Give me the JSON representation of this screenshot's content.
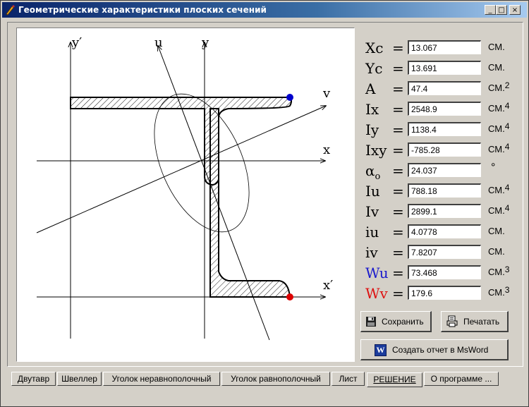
{
  "window": {
    "title": "Геометрические характеристики плоских сечений",
    "controls": {
      "minimize": "_",
      "maximize": "□",
      "close": "×"
    }
  },
  "diagram": {
    "labels": {
      "y_prime": "y′",
      "u": "u",
      "y": "y",
      "v": "v",
      "x": "x",
      "x_prime": "x′"
    },
    "colors": {
      "top_point": "#0000cc",
      "bottom_point": "#dd0000"
    }
  },
  "results": [
    {
      "symbol": "Xc",
      "value": "13.067",
      "unit": "СМ.",
      "power": "",
      "color": "#000000"
    },
    {
      "symbol": "Yc",
      "value": "13.691",
      "unit": "СМ.",
      "power": "",
      "color": "#000000"
    },
    {
      "symbol": "A",
      "value": "47.4",
      "unit": "СМ.",
      "power": "2",
      "color": "#000000"
    },
    {
      "symbol": "Ix",
      "value": "2548.9",
      "unit": "СМ.",
      "power": "4",
      "color": "#000000"
    },
    {
      "symbol": "Iy",
      "value": "1138.4",
      "unit": "СМ.",
      "power": "4",
      "color": "#000000"
    },
    {
      "symbol": "Ixy",
      "value": "-785.28",
      "unit": "СМ.",
      "power": "4",
      "color": "#000000"
    },
    {
      "symbol": "α",
      "sub": "o",
      "value": "24.037",
      "unit": "°",
      "power": "",
      "color": "#000000"
    },
    {
      "symbol": "Iu",
      "value": "788.18",
      "unit": "СМ.",
      "power": "4",
      "color": "#000000"
    },
    {
      "symbol": "Iv",
      "value": "2899.1",
      "unit": "СМ.",
      "power": "4",
      "color": "#000000"
    },
    {
      "symbol": "iu",
      "value": "4.0778",
      "unit": "СМ.",
      "power": "",
      "color": "#000000"
    },
    {
      "symbol": "iv",
      "value": "7.8207",
      "unit": "СМ.",
      "power": "",
      "color": "#000000"
    },
    {
      "symbol": "Wu",
      "value": "73.468",
      "unit": "СМ.",
      "power": "3",
      "color": "#1a1acc"
    },
    {
      "symbol": "Wv",
      "value": "179.6",
      "unit": "СМ.",
      "power": "3",
      "color": "#dd1111"
    }
  ],
  "buttons": {
    "save": "Сохранить",
    "print": "Печатать",
    "msword": "Создать отчет в MsWord",
    "word_icon_letter": "W"
  },
  "tabs": [
    {
      "label": "Двутавр",
      "active": false
    },
    {
      "label": "Швеллер",
      "active": false
    },
    {
      "label": "Уголок неравнополочный",
      "active": false
    },
    {
      "label": "Уголок равнополочный",
      "active": false
    },
    {
      "label": "Лист",
      "active": false
    },
    {
      "label": "РЕШЕНИЕ",
      "active": true
    },
    {
      "label": "О программе ...",
      "active": false
    }
  ]
}
